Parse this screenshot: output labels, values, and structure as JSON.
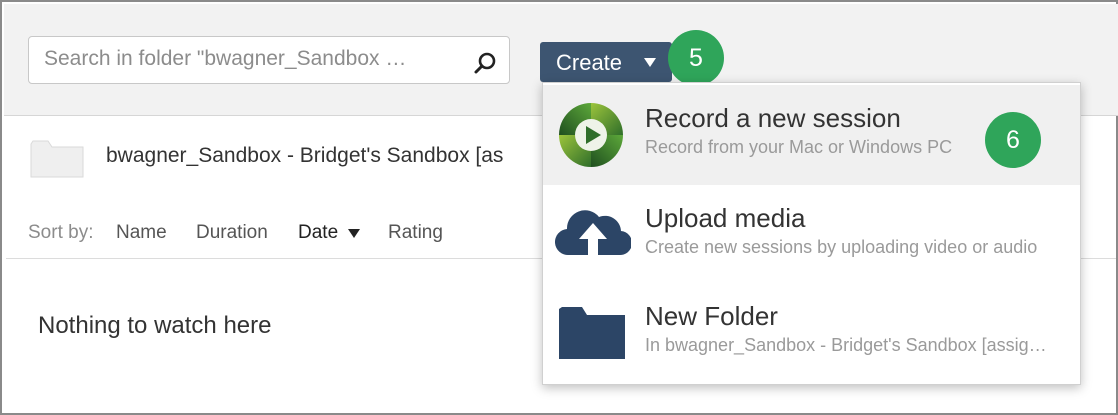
{
  "search": {
    "placeholder": "Search in folder \"bwagner_Sandbox …"
  },
  "toolbar": {
    "create_label": "Create"
  },
  "badges": {
    "create_step": "5",
    "record_step": "6"
  },
  "folder": {
    "title": "bwagner_Sandbox - Bridget's Sandbox [as"
  },
  "sort": {
    "prefix": "Sort by:",
    "options": [
      "Name",
      "Duration",
      "Date",
      "Rating"
    ],
    "active": "Date"
  },
  "empty_message": "Nothing to watch here",
  "create_menu": {
    "items": [
      {
        "title": "Record a new session",
        "subtitle": "Record from your Mac or Windows PC",
        "icon": "panopto-record-icon"
      },
      {
        "title": "Upload media",
        "subtitle": "Create new sessions by uploading video or audio",
        "icon": "cloud-upload-icon"
      },
      {
        "title": "New Folder",
        "subtitle": "In bwagner_Sandbox - Bridget's Sandbox [assig…",
        "icon": "folder-icon"
      }
    ]
  },
  "colors": {
    "create_button": "#3d5571",
    "step_badge": "#2fa55a",
    "menu_icon": "#2c4566",
    "record_icon_green": "#4c8a2e",
    "toolbar_bg": "#f2f2f2"
  }
}
